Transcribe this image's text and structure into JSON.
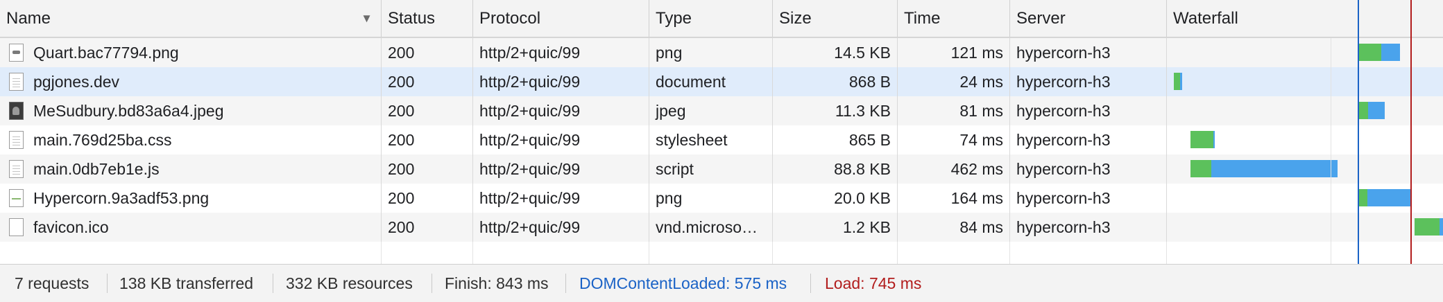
{
  "columns": {
    "name": "Name",
    "status": "Status",
    "protocol": "Protocol",
    "type": "Type",
    "size": "Size",
    "time": "Time",
    "server": "Server",
    "waterfall": "Waterfall"
  },
  "sort_indicator": "▼",
  "rows": [
    {
      "name": "Quart.bac77794.png",
      "icon": "image-file-icon",
      "status": "200",
      "protocol": "http/2+quic/99",
      "type": "png",
      "size": "14.5 KB",
      "time": "121 ms",
      "server": "hypercorn-h3"
    },
    {
      "name": "pgjones.dev",
      "icon": "document-file-icon",
      "status": "200",
      "protocol": "http/2+quic/99",
      "type": "document",
      "size": "868 B",
      "time": "24 ms",
      "server": "hypercorn-h3"
    },
    {
      "name": "MeSudbury.bd83a6a4.jpeg",
      "icon": "photo-file-icon",
      "status": "200",
      "protocol": "http/2+quic/99",
      "type": "jpeg",
      "size": "11.3 KB",
      "time": "81 ms",
      "server": "hypercorn-h3"
    },
    {
      "name": "main.769d25ba.css",
      "icon": "document-file-icon",
      "status": "200",
      "protocol": "http/2+quic/99",
      "type": "stylesheet",
      "size": "865 B",
      "time": "74 ms",
      "server": "hypercorn-h3"
    },
    {
      "name": "main.0db7eb1e.js",
      "icon": "document-file-icon",
      "status": "200",
      "protocol": "http/2+quic/99",
      "type": "script",
      "size": "88.8 KB",
      "time": "462 ms",
      "server": "hypercorn-h3"
    },
    {
      "name": "Hypercorn.9a3adf53.png",
      "icon": "image-file-icon",
      "status": "200",
      "protocol": "http/2+quic/99",
      "type": "png",
      "size": "20.0 KB",
      "time": "164 ms",
      "server": "hypercorn-h3"
    },
    {
      "name": "favicon.ico",
      "icon": "blank-file-icon",
      "status": "200",
      "protocol": "http/2+quic/99",
      "type": "vnd.microso…",
      "size": "1.2 KB",
      "time": "84 ms",
      "server": "hypercorn-h3"
    }
  ],
  "selected_row_index": 1,
  "footer": {
    "requests": "7 requests",
    "transferred": "138 KB transferred",
    "resources": "332 KB resources",
    "finish": "Finish: 843 ms",
    "dom_content_loaded": "DOMContentLoaded: 575 ms",
    "load": "Load: 745 ms"
  },
  "colors": {
    "dom_content_loaded": "#1a62c6",
    "load": "#b21d1d",
    "waiting": "#5cc15c",
    "downloading": "#4aa3ec",
    "selected_row": "#e0ecfb"
  }
}
